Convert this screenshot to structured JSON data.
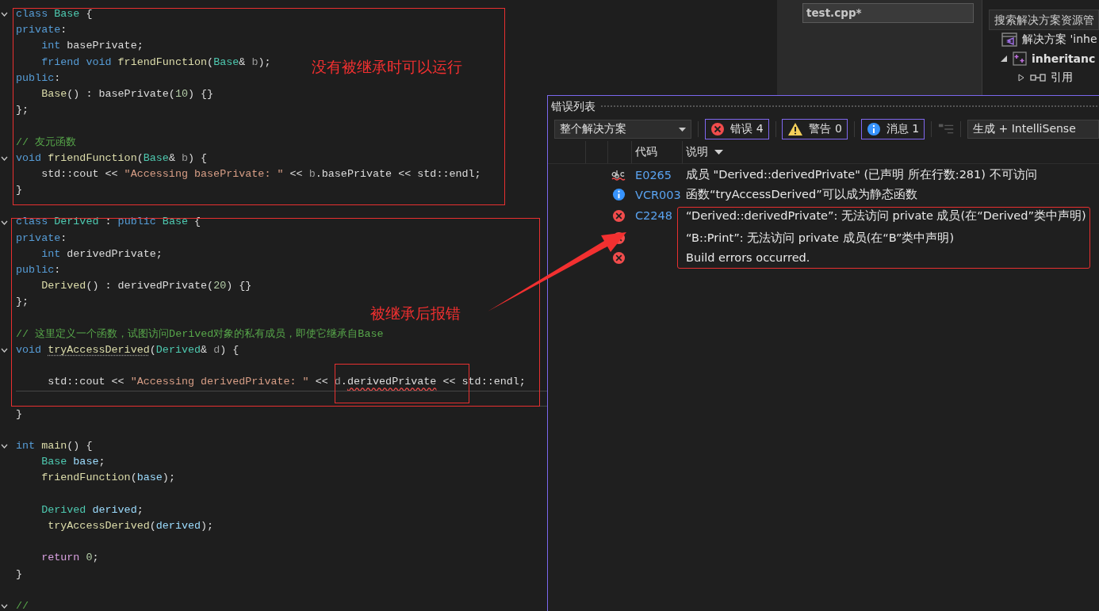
{
  "editor": {
    "lines": [
      {
        "kind": "code",
        "fold": true,
        "tokens": [
          {
            "kind": "kw",
            "text": "class"
          },
          {
            "kind": "type",
            "text": " Base"
          },
          {
            "kind": "p",
            "text": " {"
          }
        ]
      },
      {
        "kind": "code",
        "tokens": [
          {
            "kind": "kw",
            "text": "private"
          },
          {
            "kind": "p",
            "text": ":"
          }
        ]
      },
      {
        "kind": "code",
        "tokens": [
          {
            "kind": "kw",
            "text": "    int"
          },
          {
            "kind": "p",
            "text": " basePrivate;"
          }
        ]
      },
      {
        "kind": "code",
        "tokens": [
          {
            "kind": "kw",
            "text": "    friend void"
          },
          {
            "kind": "fn",
            "text": " friendFunction"
          },
          {
            "kind": "p",
            "text": "("
          },
          {
            "kind": "type",
            "text": "Base"
          },
          {
            "kind": "p",
            "text": "& "
          },
          {
            "kind": "prm",
            "text": "b"
          },
          {
            "kind": "p",
            "text": ");"
          }
        ]
      },
      {
        "kind": "code",
        "tokens": [
          {
            "kind": "kw",
            "text": "public"
          },
          {
            "kind": "p",
            "text": ":"
          }
        ]
      },
      {
        "kind": "code",
        "tokens": [
          {
            "kind": "fn",
            "text": "    Base"
          },
          {
            "kind": "p",
            "text": "() : basePrivate("
          },
          {
            "kind": "num",
            "text": "10"
          },
          {
            "kind": "p",
            "text": ") {}"
          }
        ]
      },
      {
        "kind": "code",
        "tokens": [
          {
            "kind": "p",
            "text": "};"
          }
        ]
      },
      {
        "kind": "blank"
      },
      {
        "kind": "code",
        "tokens": [
          {
            "kind": "cm",
            "text": "// 友元函数"
          }
        ]
      },
      {
        "kind": "code",
        "fold": true,
        "tokens": [
          {
            "kind": "kw",
            "text": "void"
          },
          {
            "kind": "fn",
            "text": " friendFunction"
          },
          {
            "kind": "p",
            "text": "("
          },
          {
            "kind": "type",
            "text": "Base"
          },
          {
            "kind": "p",
            "text": "& "
          },
          {
            "kind": "prm",
            "text": "b"
          },
          {
            "kind": "p",
            "text": ") {"
          }
        ]
      },
      {
        "kind": "code",
        "tokens": [
          {
            "kind": "p",
            "text": "    std::cout << "
          },
          {
            "kind": "str",
            "text": "\"Accessing basePrivate: \""
          },
          {
            "kind": "p",
            "text": " << "
          },
          {
            "kind": "prm",
            "text": "b"
          },
          {
            "kind": "p",
            "text": ".basePrivate << std::endl;"
          }
        ]
      },
      {
        "kind": "code",
        "tokens": [
          {
            "kind": "p",
            "text": "}"
          }
        ]
      },
      {
        "kind": "blank"
      },
      {
        "kind": "code",
        "fold": true,
        "tokens": [
          {
            "kind": "kw",
            "text": "class"
          },
          {
            "kind": "type",
            "text": " Derived"
          },
          {
            "kind": "p",
            "text": " : "
          },
          {
            "kind": "kw",
            "text": "public"
          },
          {
            "kind": "type",
            "text": " Base"
          },
          {
            "kind": "p",
            "text": " {"
          }
        ]
      },
      {
        "kind": "code",
        "tokens": [
          {
            "kind": "kw",
            "text": "private"
          },
          {
            "kind": "p",
            "text": ":"
          }
        ]
      },
      {
        "kind": "code",
        "tokens": [
          {
            "kind": "kw",
            "text": "    int"
          },
          {
            "kind": "p",
            "text": " derivedPrivate;"
          }
        ]
      },
      {
        "kind": "code",
        "tokens": [
          {
            "kind": "kw",
            "text": "public"
          },
          {
            "kind": "p",
            "text": ":"
          }
        ]
      },
      {
        "kind": "code",
        "tokens": [
          {
            "kind": "fn",
            "text": "    Derived"
          },
          {
            "kind": "p",
            "text": "() : derivedPrivate("
          },
          {
            "kind": "num",
            "text": "20"
          },
          {
            "kind": "p",
            "text": ") {}"
          }
        ]
      },
      {
        "kind": "code",
        "tokens": [
          {
            "kind": "p",
            "text": "};"
          }
        ]
      },
      {
        "kind": "blank"
      },
      {
        "kind": "code",
        "tokens": [
          {
            "kind": "cm",
            "text": "// 这里定义一个函数，试图访问Derived对象的私有成员，即使它继承自Base"
          }
        ]
      },
      {
        "kind": "code",
        "fold": true,
        "tokens": [
          {
            "kind": "kw",
            "text": "void "
          },
          {
            "kind": "hint",
            "text": "tryAccessDerived"
          },
          {
            "kind": "p",
            "text": "("
          },
          {
            "kind": "type",
            "text": "Derived"
          },
          {
            "kind": "p",
            "text": "& "
          },
          {
            "kind": "prm",
            "text": "d"
          },
          {
            "kind": "p",
            "text": ") {"
          }
        ]
      },
      {
        "kind": "blank"
      },
      {
        "kind": "code",
        "tokens": [
          {
            "kind": "p",
            "text": "     std::cout << "
          },
          {
            "kind": "str",
            "text": "\"Accessing derivedPrivate: \""
          },
          {
            "kind": "p",
            "text": " << "
          },
          {
            "kind": "prm",
            "text": "d"
          },
          {
            "kind": "p",
            "text": "."
          },
          {
            "kind": "err",
            "text": "derivedPrivate"
          },
          {
            "kind": "p",
            "text": " << std::endl;"
          }
        ]
      },
      {
        "kind": "blank",
        "current": true
      },
      {
        "kind": "code",
        "tokens": [
          {
            "kind": "p",
            "text": "}"
          }
        ]
      },
      {
        "kind": "blank"
      },
      {
        "kind": "code",
        "fold": true,
        "tokens": [
          {
            "kind": "kw",
            "text": "int"
          },
          {
            "kind": "fn",
            "text": " main"
          },
          {
            "kind": "p",
            "text": "() {"
          }
        ]
      },
      {
        "kind": "code",
        "tokens": [
          {
            "kind": "type",
            "text": "    Base"
          },
          {
            "kind": "var",
            "text": " base"
          },
          {
            "kind": "p",
            "text": ";"
          }
        ]
      },
      {
        "kind": "code",
        "tokens": [
          {
            "kind": "fn",
            "text": "    friendFunction"
          },
          {
            "kind": "p",
            "text": "("
          },
          {
            "kind": "var",
            "text": "base"
          },
          {
            "kind": "p",
            "text": ");"
          }
        ]
      },
      {
        "kind": "blank"
      },
      {
        "kind": "code",
        "tokens": [
          {
            "kind": "type",
            "text": "    Derived"
          },
          {
            "kind": "var",
            "text": " derived"
          },
          {
            "kind": "p",
            "text": ";"
          }
        ]
      },
      {
        "kind": "code",
        "tokens": [
          {
            "kind": "fn",
            "text": "     tryAccessDerived"
          },
          {
            "kind": "p",
            "text": "("
          },
          {
            "kind": "var",
            "text": "derived"
          },
          {
            "kind": "p",
            "text": ");"
          }
        ]
      },
      {
        "kind": "blank"
      },
      {
        "kind": "code",
        "tokens": [
          {
            "kind": "ctl",
            "text": "    return"
          },
          {
            "kind": "num",
            "text": " 0"
          },
          {
            "kind": "p",
            "text": ";"
          }
        ]
      },
      {
        "kind": "code",
        "tokens": [
          {
            "kind": "p",
            "text": "}"
          }
        ]
      },
      {
        "kind": "blank"
      },
      {
        "kind": "code",
        "fold": true,
        "tokens": [
          {
            "kind": "cm",
            "text": "//"
          }
        ]
      }
    ]
  },
  "annotations": [
    {
      "text": "没有被继承时可以运行"
    },
    {
      "text": "被继承后报错"
    }
  ],
  "document_tab": {
    "title": "test.cpp*"
  },
  "solution_explorer": {
    "search": {
      "placeholder": "搜索解决方案资源管"
    },
    "tree": [
      {
        "kind": "solution",
        "label": "解决方案 'inhe",
        "children": [
          {
            "kind": "project",
            "label": "inheritanc",
            "expanded": true,
            "children": [
              {
                "kind": "references",
                "label": "引用",
                "expanded": false
              }
            ]
          }
        ]
      }
    ]
  },
  "error_list": {
    "title": "错误列表",
    "scope": "整个解决方案",
    "filters": [
      {
        "kind": "error",
        "label": "错误 4",
        "selected": true
      },
      {
        "kind": "warning",
        "label": "警告 0",
        "selected": true
      },
      {
        "kind": "info",
        "label": "消息 1",
        "selected": true
      }
    ],
    "source": "生成 + IntelliSense",
    "columns": [
      {
        "label": "代码",
        "sorted": false
      },
      {
        "label": "说明",
        "sorted": true
      }
    ],
    "rows": [
      {
        "kind": "spelling",
        "code": "E0265",
        "description": "成员 \"Derived::derivedPrivate\" (已声明 所在行数:281) 不可访问"
      },
      {
        "kind": "info",
        "code": "VCR003",
        "description": "函数“tryAccessDerived”可以成为静态函数"
      },
      {
        "kind": "error",
        "code": "C2248",
        "description": "“Derived::derivedPrivate”: 无法访问 private 成员(在“Derived”类中声明)"
      },
      {
        "kind": "error",
        "description": "“B::Print”: 无法访问 private 成员(在“B”类中声明)"
      },
      {
        "kind": "error",
        "description": "Build errors occurred."
      }
    ]
  }
}
